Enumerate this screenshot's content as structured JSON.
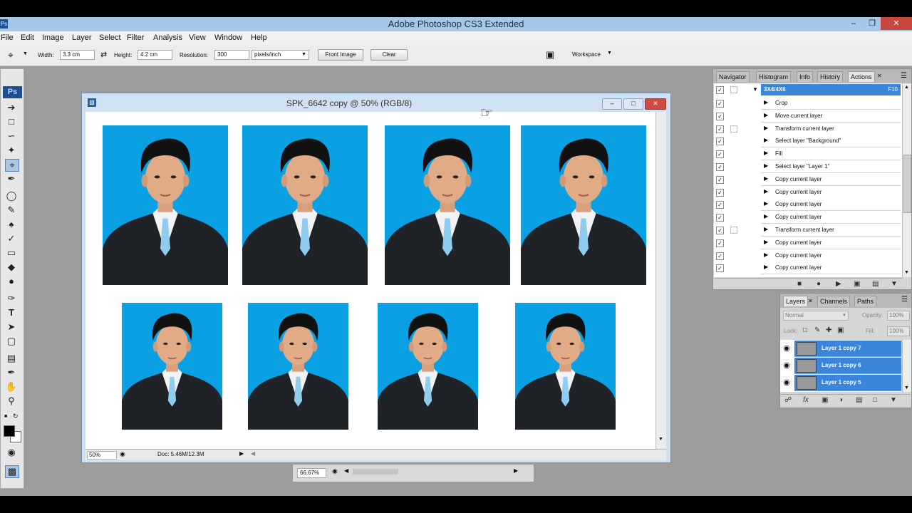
{
  "app": {
    "title": "Adobe Photoshop CS3 Extended",
    "logo": "Ps"
  },
  "menu": [
    "File",
    "Edit",
    "Image",
    "Layer",
    "Select",
    "Filter",
    "Analysis",
    "View",
    "Window",
    "Help"
  ],
  "options": {
    "width_label": "Width:",
    "width_value": "3.3 cm",
    "height_label": "Height:",
    "height_value": "4.2 cm",
    "resolution_label": "Resolution:",
    "resolution_value": "300",
    "units_value": "pixels/inch",
    "front_image": "Front Image",
    "clear": "Clear",
    "workspace": "Workspace"
  },
  "document": {
    "title": "SPK_6642 copy @ 50% (RGB/8)",
    "zoom": "50%",
    "doc_info": "Doc: 5.46M/12.3M",
    "photo_color": "#0aa1e4"
  },
  "second_doc": {
    "zoom": "66.67%"
  },
  "actions_panel": {
    "tabs": [
      "Navigator",
      "Histogram",
      "Info",
      "History",
      "Actions"
    ],
    "set_name": "3X4/4X6",
    "set_key": "F10",
    "steps": [
      "Crop",
      "Move current layer",
      "Transform current layer",
      "Select layer \"Background\"",
      "Fill",
      "Select layer \"Layer 1\"",
      "Copy current layer",
      "Copy current layer",
      "Copy current layer",
      "Copy current layer",
      "Transform current layer",
      "Copy current layer",
      "Copy current layer",
      "Copy current layer"
    ]
  },
  "layers_panel": {
    "tabs": [
      "Layers",
      "Channels",
      "Paths"
    ],
    "blend_mode": "Normal",
    "opacity_label": "Opacity:",
    "opacity_value": "100%",
    "lock_label": "Lock:",
    "fill_label": "Fill:",
    "fill_value": "100%",
    "layers": [
      "Layer 1 copy 7",
      "Layer 1 copy 6",
      "Layer 1 copy 5"
    ]
  }
}
